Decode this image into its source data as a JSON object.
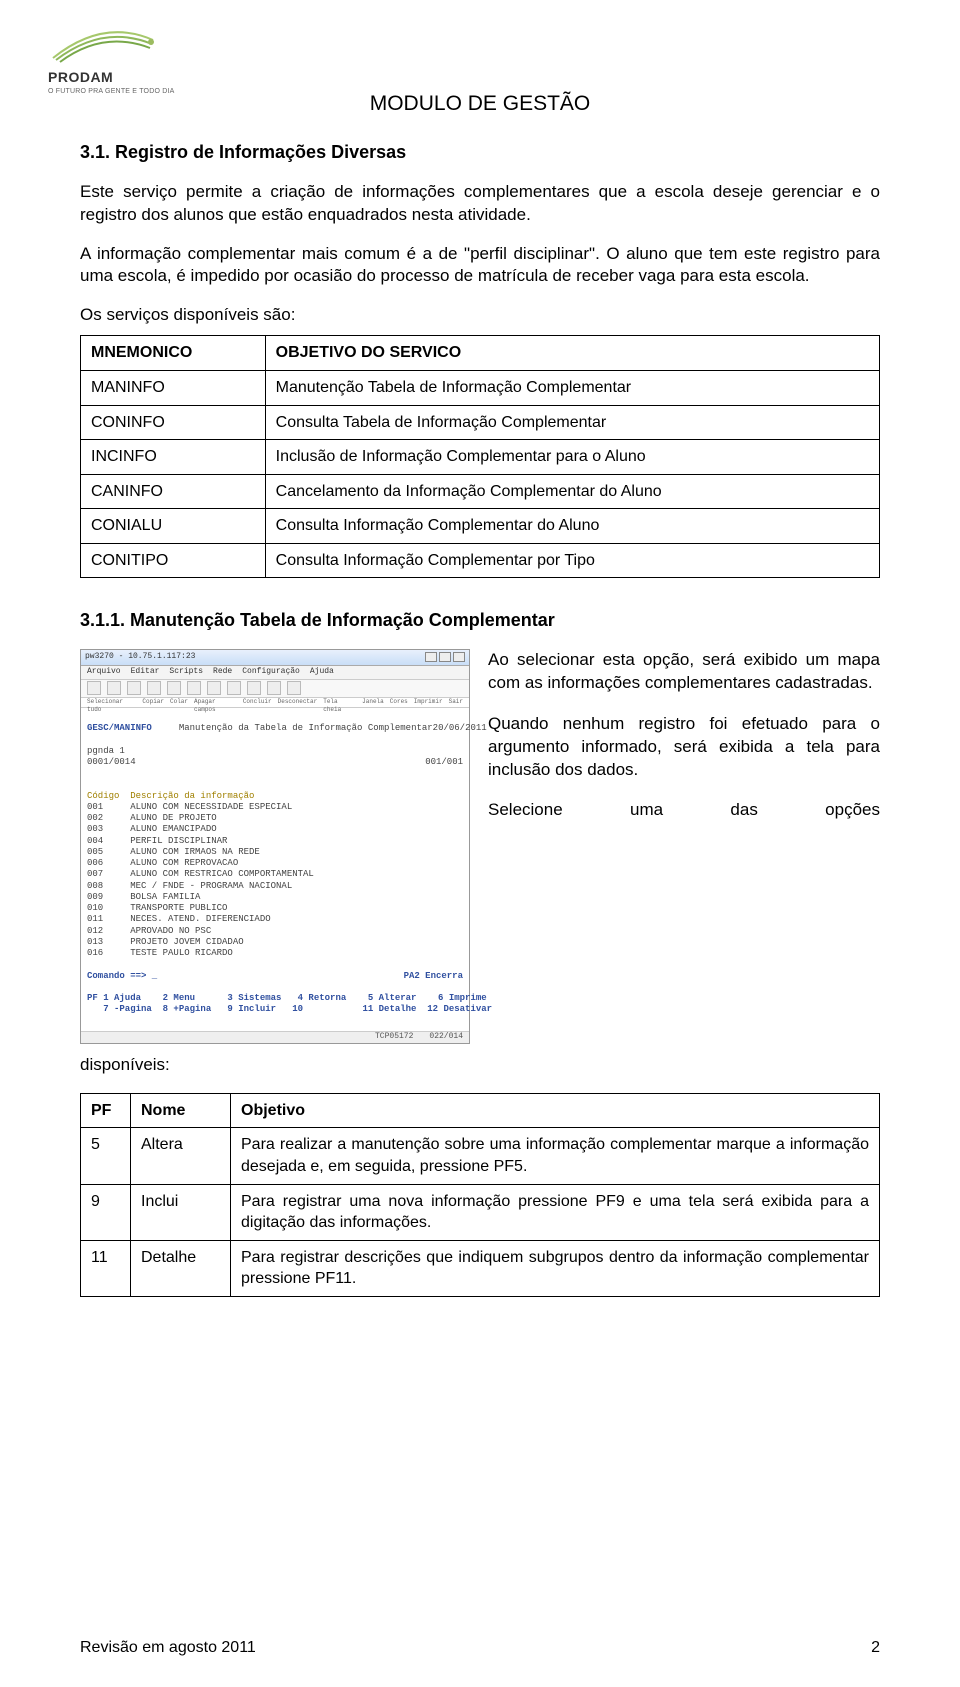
{
  "logo": {
    "brand": "PRODAM",
    "tagline": "O FUTURO PRA GENTE E TODO DIA"
  },
  "module_title": "MODULO DE GESTÃO",
  "section_heading": "3.1. Registro de Informações Diversas",
  "para1": "Este serviço permite a criação de informações complementares que a escola deseje gerenciar e o registro dos alunos que estão enquadrados nesta atividade.",
  "para2": "A informação complementar mais comum é a de \"perfil disciplinar\". O aluno que tem este registro para uma escola, é impedido por ocasião do processo de matrícula de receber vaga para esta escola.",
  "services_intro": "Os serviços disponíveis são:",
  "services_table": {
    "head": {
      "c1": "MNEMONICO",
      "c2": "OBJETIVO DO SERVICO"
    },
    "rows": [
      {
        "c1": "MANINFO",
        "c2": "Manutenção Tabela de Informação Complementar"
      },
      {
        "c1": "CONINFO",
        "c2": "Consulta Tabela de Informação Complementar"
      },
      {
        "c1": "INCINFO",
        "c2": "Inclusão de Informação Complementar para o Aluno"
      },
      {
        "c1": "CANINFO",
        "c2": "Cancelamento da Informação Complementar do Aluno"
      },
      {
        "c1": "CONIALU",
        "c2": "Consulta Informação Complementar do Aluno"
      },
      {
        "c1": "CONITIPO",
        "c2": "Consulta Informação Complementar por Tipo"
      }
    ]
  },
  "subsection_heading": "3.1.1. Manutenção Tabela de Informação Complementar",
  "screenshot": {
    "window_title": "pw3270 - 10.75.1.117:23",
    "menu": [
      "Arquivo",
      "Editar",
      "Scripts",
      "Rede",
      "Configuração",
      "Ajuda"
    ],
    "toolbar_labels": [
      "Selecionar tudo",
      "Copiar",
      "Colar",
      "Apagar campos",
      "Concluir",
      "Desconectar",
      "Tela cheia",
      "Janela",
      "Cores",
      "Imprimir",
      "Sair"
    ],
    "header_left": "GESC/MANINFO",
    "header_center": "Manutenção da Tabela de Informação Complementar",
    "header_date": "20/06/2011",
    "pgnda": "pgnda 1",
    "counter_left": "0001/0014",
    "counter_right": "001/001",
    "col_head": "Código  Descrição da informação",
    "rows": [
      "001     ALUNO COM NECESSIDADE ESPECIAL",
      "002     ALUNO DE PROJETO",
      "003     ALUNO EMANCIPADO",
      "004     PERFIL DISCIPLINAR",
      "005     ALUNO COM IRMAOS NA REDE",
      "006     ALUNO COM REPROVACAO",
      "007     ALUNO COM RESTRICAO COMPORTAMENTAL",
      "008     MEC / FNDE - PROGRAMA NACIONAL",
      "009     BOLSA FAMILIA",
      "010     TRANSPORTE PUBLICO",
      "011     NECES. ATEND. DIFERENCIADO",
      "012     APROVADO NO PSC",
      "013     PROJETO JOVEM CIDADAO",
      "016     TESTE PAULO RICARDO"
    ],
    "cmd_prompt": "Comando ==> _",
    "pa2": "PA2 Encerra",
    "pf_line1": "PF 1 Ajuda    2 Menu      3 Sistemas   4 Retorna    5 Alterar    6 Imprime",
    "pf_line2": "   7 -Pagina  8 +Pagina   9 Incluir   10           11 Detalhe  12 Desativar",
    "status_tcp": "TCP05172",
    "status_pos": "022/014"
  },
  "right_block": {
    "p1": "Ao selecionar esta opção, será exibido um mapa com as informações complementares cadastradas.",
    "p2": "Quando nenhum registro foi efetuado para o argumento informado, será exibida a tela para inclusão dos dados.",
    "sel_1": "Selecione",
    "sel_2": "uma",
    "sel_3": "das",
    "sel_4": "opções"
  },
  "disponiveis": "disponíveis:",
  "pf_table": {
    "head": {
      "c1": "PF",
      "c2": "Nome",
      "c3": "Objetivo"
    },
    "rows": [
      {
        "c1": "5",
        "c2": "Altera",
        "c3": "Para realizar a manutenção sobre uma informação complementar marque a informação desejada e, em seguida, pressione PF5."
      },
      {
        "c1": "9",
        "c2": "Inclui",
        "c3": "Para registrar uma nova informação pressione PF9 e uma tela será exibida para a digitação das informações."
      },
      {
        "c1": "11",
        "c2": "Detalhe",
        "c3": "Para registrar descrições que indiquem subgrupos dentro da informação complementar pressione PF11."
      }
    ]
  },
  "footer": {
    "left": "Revisão em agosto 2011",
    "right": "2"
  }
}
